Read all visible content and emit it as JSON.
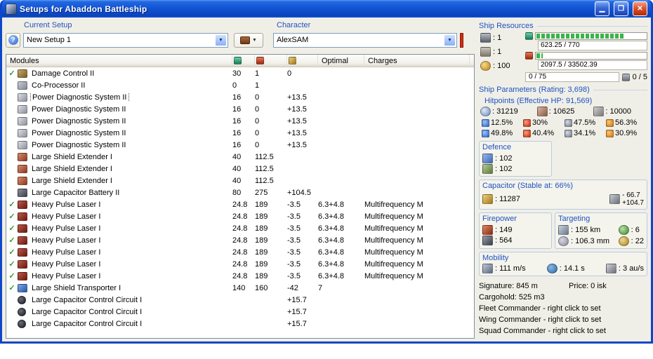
{
  "window": {
    "title": "Setups for Abaddon Battleship"
  },
  "setup": {
    "current_setup_label": "Current Setup",
    "current_setup_value": "New Setup 1",
    "character_label": "Character",
    "character_value": "AlexSAM",
    "help_glyph": "?",
    "dropdown_glyph": "▼"
  },
  "modules_table": {
    "headers": {
      "modules": "Modules",
      "optimal": "Optimal",
      "charges": "Charges"
    },
    "check_glyph": "✓",
    "rows": [
      {
        "checked": true,
        "selected": false,
        "icon": "damage-control",
        "name": "Damage Control II",
        "cpu": "30",
        "pg": "1",
        "cap": "0",
        "optimal": "",
        "charges": ""
      },
      {
        "checked": false,
        "selected": false,
        "icon": "co-processor",
        "name": "Co-Processor II",
        "cpu": "0",
        "pg": "1",
        "cap": "",
        "optimal": "",
        "charges": ""
      },
      {
        "checked": false,
        "selected": true,
        "icon": "power-diagnostic",
        "name": "Power Diagnostic System II",
        "cpu": "16",
        "pg": "0",
        "cap": "+13.5",
        "optimal": "",
        "charges": ""
      },
      {
        "checked": false,
        "selected": false,
        "icon": "power-diagnostic",
        "name": "Power Diagnostic System II",
        "cpu": "16",
        "pg": "0",
        "cap": "+13.5",
        "optimal": "",
        "charges": ""
      },
      {
        "checked": false,
        "selected": false,
        "icon": "power-diagnostic",
        "name": "Power Diagnostic System II",
        "cpu": "16",
        "pg": "0",
        "cap": "+13.5",
        "optimal": "",
        "charges": ""
      },
      {
        "checked": false,
        "selected": false,
        "icon": "power-diagnostic",
        "name": "Power Diagnostic System II",
        "cpu": "16",
        "pg": "0",
        "cap": "+13.5",
        "optimal": "",
        "charges": ""
      },
      {
        "checked": false,
        "selected": false,
        "icon": "power-diagnostic",
        "name": "Power Diagnostic System II",
        "cpu": "16",
        "pg": "0",
        "cap": "+13.5",
        "optimal": "",
        "charges": ""
      },
      {
        "checked": false,
        "selected": false,
        "icon": "shield-extender",
        "name": "Large Shield Extender I",
        "cpu": "40",
        "pg": "112.5",
        "cap": "",
        "optimal": "",
        "charges": ""
      },
      {
        "checked": false,
        "selected": false,
        "icon": "shield-extender",
        "name": "Large Shield Extender I",
        "cpu": "40",
        "pg": "112.5",
        "cap": "",
        "optimal": "",
        "charges": ""
      },
      {
        "checked": false,
        "selected": false,
        "icon": "shield-extender",
        "name": "Large Shield Extender I",
        "cpu": "40",
        "pg": "112.5",
        "cap": "",
        "optimal": "",
        "charges": ""
      },
      {
        "checked": false,
        "selected": false,
        "icon": "capacitor-battery",
        "name": "Large Capacitor Battery II",
        "cpu": "80",
        "pg": "275",
        "cap": "+104.5",
        "optimal": "",
        "charges": ""
      },
      {
        "checked": true,
        "selected": false,
        "icon": "pulse-laser",
        "name": "Heavy Pulse Laser I",
        "cpu": "24.8",
        "pg": "189",
        "cap": "-3.5",
        "optimal": "6.3+4.8",
        "charges": "Multifrequency M"
      },
      {
        "checked": true,
        "selected": false,
        "icon": "pulse-laser",
        "name": "Heavy Pulse Laser I",
        "cpu": "24.8",
        "pg": "189",
        "cap": "-3.5",
        "optimal": "6.3+4.8",
        "charges": "Multifrequency M"
      },
      {
        "checked": true,
        "selected": false,
        "icon": "pulse-laser",
        "name": "Heavy Pulse Laser I",
        "cpu": "24.8",
        "pg": "189",
        "cap": "-3.5",
        "optimal": "6.3+4.8",
        "charges": "Multifrequency M"
      },
      {
        "checked": true,
        "selected": false,
        "icon": "pulse-laser",
        "name": "Heavy Pulse Laser I",
        "cpu": "24.8",
        "pg": "189",
        "cap": "-3.5",
        "optimal": "6.3+4.8",
        "charges": "Multifrequency M"
      },
      {
        "checked": true,
        "selected": false,
        "icon": "pulse-laser",
        "name": "Heavy Pulse Laser I",
        "cpu": "24.8",
        "pg": "189",
        "cap": "-3.5",
        "optimal": "6.3+4.8",
        "charges": "Multifrequency M"
      },
      {
        "checked": true,
        "selected": false,
        "icon": "pulse-laser",
        "name": "Heavy Pulse Laser I",
        "cpu": "24.8",
        "pg": "189",
        "cap": "-3.5",
        "optimal": "6.3+4.8",
        "charges": "Multifrequency M"
      },
      {
        "checked": true,
        "selected": false,
        "icon": "pulse-laser",
        "name": "Heavy Pulse Laser I",
        "cpu": "24.8",
        "pg": "189",
        "cap": "-3.5",
        "optimal": "6.3+4.8",
        "charges": "Multifrequency M"
      },
      {
        "checked": true,
        "selected": false,
        "icon": "shield-transporter",
        "name": "Large Shield Transporter I",
        "cpu": "140",
        "pg": "160",
        "cap": "-42",
        "optimal": "7",
        "charges": ""
      },
      {
        "checked": false,
        "selected": false,
        "icon": "cap-control-circuit",
        "name": "Large Capacitor Control Circuit I",
        "cpu": "",
        "pg": "",
        "cap": "+15.7",
        "optimal": "",
        "charges": ""
      },
      {
        "checked": false,
        "selected": false,
        "icon": "cap-control-circuit",
        "name": "Large Capacitor Control Circuit I",
        "cpu": "",
        "pg": "",
        "cap": "+15.7",
        "optimal": "",
        "charges": ""
      },
      {
        "checked": false,
        "selected": false,
        "icon": "cap-control-circuit",
        "name": "Large Capacitor Control Circuit I",
        "cpu": "",
        "pg": "",
        "cap": "+15.7",
        "optimal": "",
        "charges": ""
      }
    ]
  },
  "ship_resources": {
    "title": "Ship Resources",
    "turret_slots": ": 1",
    "launcher_slots": ": 1",
    "calibration": ": 100",
    "cpu_text": "623.25 / 770",
    "cpu_fill_pct": 81,
    "powergrid_text": "2097.5 / 33502.39",
    "powergrid_fill_pct": 6,
    "drone_bay_text": "0 / 75",
    "drone_slots_text": "0 / 5"
  },
  "ship_parameters": {
    "title": "Ship Parameters (Rating: 3,698)",
    "hitpoints_title": "Hitpoints (Effective HP: 91,569)",
    "shield_hp": ": 31219",
    "armor_hp": ": 10625",
    "structure_hp": ": 10000",
    "resists": [
      {
        "type": "em",
        "shield": "12.5%",
        "armor": "49.8%"
      },
      {
        "type": "thermal",
        "shield": "30%",
        "armor": "40.4%"
      },
      {
        "type": "kinetic",
        "shield": "47.5%",
        "armor": "34.1%"
      },
      {
        "type": "explosive",
        "shield": "56.3%",
        "armor": "30.9%"
      }
    ],
    "defence": {
      "title": "Defence",
      "shield_value": ": 102",
      "armor_value": ": 102"
    },
    "capacitor": {
      "title": "Capacitor (Stable at: 66%)",
      "amount": ": 11287",
      "drain": "- 66.7",
      "recharge": "+104.7"
    },
    "firepower": {
      "title": "Firepower",
      "dps": ": 149",
      "volley": ": 564"
    },
    "targeting": {
      "title": "Targeting",
      "range": ": 155 km",
      "max_targets": ": 6",
      "scan_res": ": 106.3 mm",
      "sensor_strength": ": 22"
    },
    "mobility": {
      "title": "Mobility",
      "speed": ": 111 m/s",
      "align_time": ": 14.1 s",
      "warp_speed": ": 3 au/s"
    },
    "signature": "Signature: 845 m",
    "price": "Price: 0 isk",
    "cargohold": "Cargohold: 525 m3",
    "fleet_commander": "Fleet Commander - right click to set",
    "wing_commander": "Wing Commander - right click to set",
    "squad_commander": "Squad Commander - right click to set"
  }
}
